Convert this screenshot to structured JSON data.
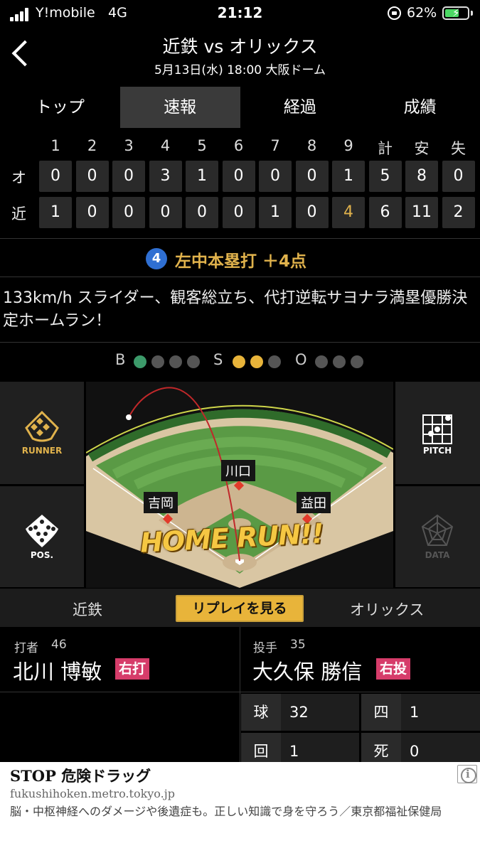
{
  "status_bar": {
    "carrier": "Y!mobile",
    "network": "4G",
    "time": "21:12",
    "battery_pct": "62%",
    "battery_level": 0.62
  },
  "header": {
    "title": "近鉄 vs オリックス",
    "subtitle": "5月13日(水) 18:00 大阪ドーム"
  },
  "tabs": [
    {
      "label": "トップ",
      "active": false
    },
    {
      "label": "速報",
      "active": true
    },
    {
      "label": "経過",
      "active": false
    },
    {
      "label": "成績",
      "active": false
    }
  ],
  "scoreboard": {
    "headers": [
      "1",
      "2",
      "3",
      "4",
      "5",
      "6",
      "7",
      "8",
      "9",
      "計",
      "安",
      "失"
    ],
    "rows": [
      {
        "team": "オ",
        "cells": [
          "0",
          "0",
          "0",
          "3",
          "1",
          "0",
          "0",
          "0",
          "1",
          "5",
          "8",
          "0"
        ]
      },
      {
        "team": "近",
        "cells": [
          "1",
          "0",
          "0",
          "0",
          "0",
          "0",
          "1",
          "0",
          "4",
          "6",
          "11",
          "2"
        ]
      }
    ]
  },
  "play": {
    "badge": "4",
    "result": "左中本塁打 ＋4点",
    "description": "133km/h スライダー、観客総立ち、代打逆転サヨナラ満塁優勝決定ホームラン！"
  },
  "count": {
    "labels": {
      "ball": "B",
      "strike": "S",
      "out": "O"
    },
    "balls": 1,
    "ball_max": 4,
    "strikes": 2,
    "strike_max": 3,
    "outs": 0,
    "out_max": 3,
    "colors": {
      "ball": "#3c9a6a",
      "strike": "#e8b43a",
      "off": "#555555"
    }
  },
  "side_buttons": {
    "runner": "RUNNER",
    "pos": "POS.",
    "pitch": "PITCH",
    "data": "DATA"
  },
  "field": {
    "fielders": [
      "川口",
      "吉岡",
      "益田"
    ],
    "homerun_text": "HOME RUN!!"
  },
  "team_toggle": {
    "home": "近鉄",
    "replay": "リプレイを見る",
    "away": "オリックス"
  },
  "batter": {
    "label": "打者",
    "number": "46",
    "name": "北川 博敏",
    "hand": "右打"
  },
  "pitcher": {
    "label": "投手",
    "number": "35",
    "name": "大久保 勝信",
    "hand": "右投",
    "stats": [
      {
        "key": "球",
        "value": "32"
      },
      {
        "key": "四",
        "value": "1"
      },
      {
        "key": "回",
        "value": "1"
      },
      {
        "key": "死",
        "value": "0"
      }
    ]
  },
  "ad": {
    "title": "STOP 危険ドラッグ",
    "url": "fukushihoken.metro.tokyo.jp",
    "body": "脳・中枢神経へのダメージや後遺症も。正しい知識で身を守ろう／東京都福祉保健局"
  },
  "colors": {
    "accent": "#e0b24c",
    "badge_pink": "#d63c6a",
    "play_badge": "#2f6fd2"
  }
}
